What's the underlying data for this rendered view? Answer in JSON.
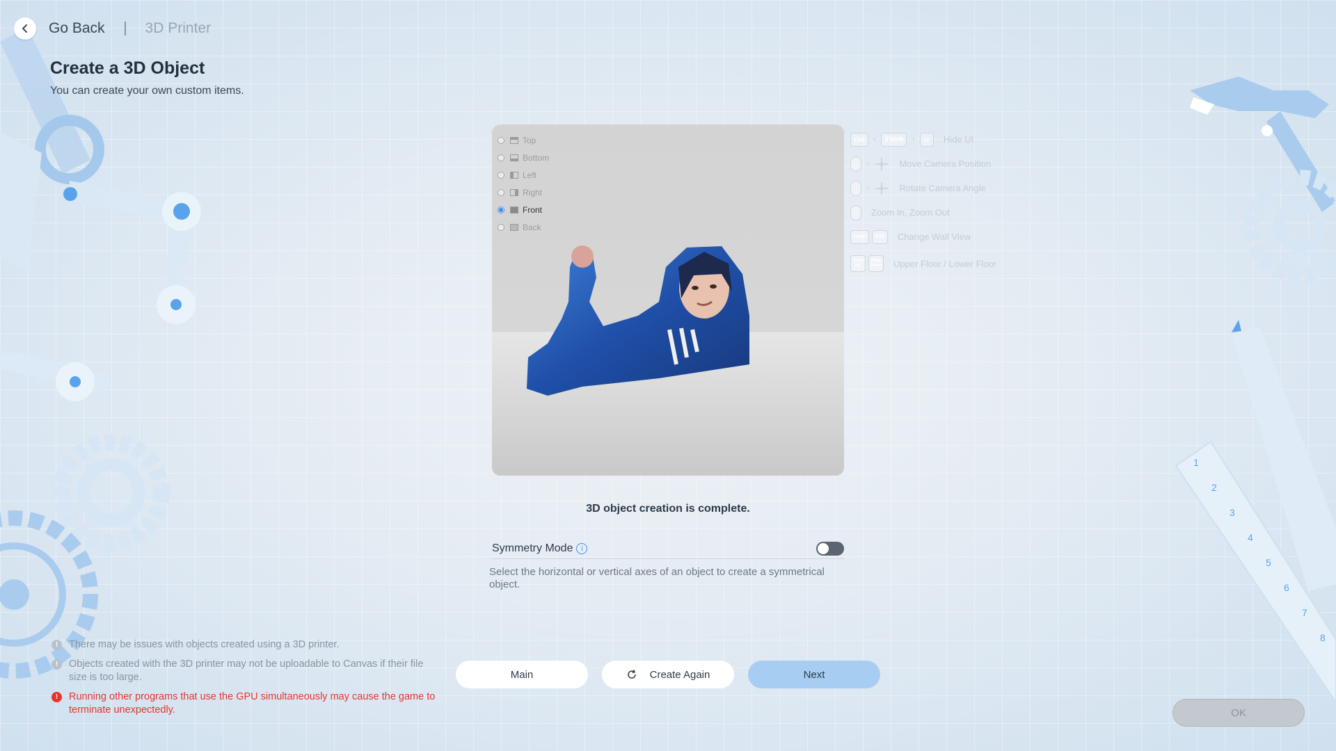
{
  "header": {
    "back_label": "Go Back",
    "breadcrumb": "3D Printer"
  },
  "page": {
    "title": "Create a 3D Object",
    "subtitle": "You can create your own custom items."
  },
  "viewport": {
    "views": [
      {
        "label": "Top",
        "icon": "cube-top-icon",
        "selected": false
      },
      {
        "label": "Bottom",
        "icon": "cube-bottom-icon",
        "selected": false
      },
      {
        "label": "Left",
        "icon": "cube-left-icon",
        "selected": false
      },
      {
        "label": "Right",
        "icon": "cube-right-icon",
        "selected": false
      },
      {
        "label": "Front",
        "icon": "cube-front-icon",
        "selected": true
      },
      {
        "label": "Back",
        "icon": "cube-back-icon",
        "selected": false
      }
    ]
  },
  "shortcuts": {
    "keys": {
      "ctrl": "Ctrl",
      "shift": "⇧Shift",
      "u": "U",
      "home": "Home",
      "end": "End",
      "page_up": "Page Up",
      "page_down": "Page Down"
    },
    "hide_ui": "Hide UI",
    "move_camera": "Move Camera Position",
    "rotate_camera": "Rotate Camera Angle",
    "zoom": "Zoom In, Zoom Out",
    "wall_view": "Change Wall View",
    "floor": "Upper Floor / Lower Floor"
  },
  "status": "3D object creation is complete.",
  "symmetry": {
    "label": "Symmetry Mode",
    "enabled": false,
    "description": "Select the horizontal or vertical axes of an object to create a symmetrical object."
  },
  "warnings": [
    {
      "text": "There may be issues with objects created using a 3D printer.",
      "level": "info"
    },
    {
      "text": "Objects created with the 3D printer may not be uploadable to Canvas if their file size is too large.",
      "level": "info"
    },
    {
      "text": "Running other programs that use the GPU simultaneously may cause the game to terminate unexpectedly.",
      "level": "error"
    }
  ],
  "buttons": {
    "main": "Main",
    "create_again": "Create Again",
    "next": "Next",
    "ok": "OK"
  },
  "colors": {
    "accent": "#4a8ee8",
    "next_button": "#a8cdf2",
    "error": "#e8332b"
  }
}
